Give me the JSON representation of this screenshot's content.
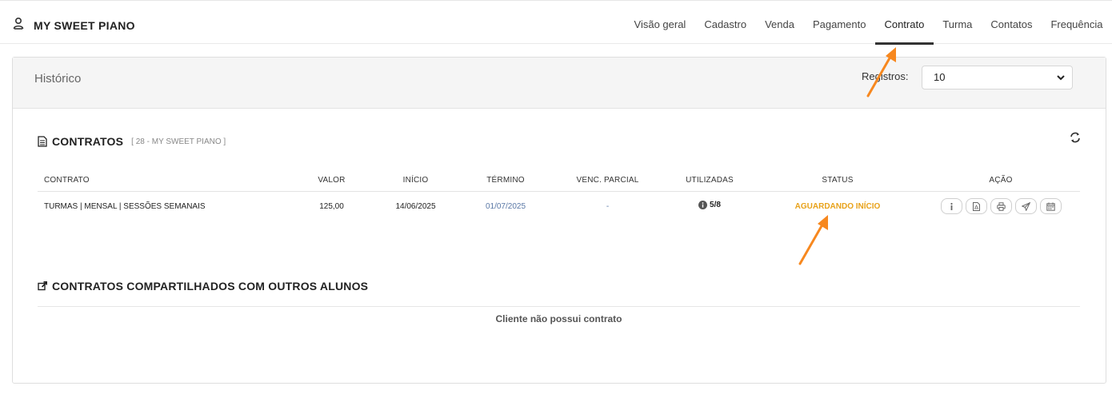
{
  "brand": {
    "name": "MY SWEET PIANO",
    "icon": "user-icon"
  },
  "nav": {
    "items": [
      {
        "label": "Visão geral",
        "active": false
      },
      {
        "label": "Cadastro",
        "active": false
      },
      {
        "label": "Venda",
        "active": false
      },
      {
        "label": "Pagamento",
        "active": false
      },
      {
        "label": "Contrato",
        "active": true
      },
      {
        "label": "Turma",
        "active": false
      },
      {
        "label": "Contatos",
        "active": false
      },
      {
        "label": "Frequência",
        "active": false
      }
    ]
  },
  "panel": {
    "title": "Histórico",
    "registros_label": "Registros:",
    "registros_value": "10"
  },
  "contracts": {
    "title": "CONTRATOS",
    "subtitle": "[ 28 - MY SWEET PIANO ]",
    "columns": [
      "CONTRATO",
      "VALOR",
      "INÍCIO",
      "TÉRMINO",
      "VENC. PARCIAL",
      "UTILIZADAS",
      "STATUS",
      "AÇÃO"
    ],
    "rows": [
      {
        "contrato": "TURMAS | MENSAL | SESSÕES SEMANAIS",
        "valor": "125,00",
        "inicio": "14/06/2025",
        "termino": "01/07/2025",
        "venc_parcial": "-",
        "utilizadas": "5/8",
        "status": "AGUARDANDO INÍCIO"
      }
    ],
    "action_icons": [
      "info-icon",
      "pdf-icon",
      "print-icon",
      "send-icon",
      "calendar-icon"
    ]
  },
  "shared": {
    "title": "CONTRATOS COMPARTILHADOS COM OUTROS ALUNOS",
    "empty_message": "Cliente não possui contrato"
  },
  "colors": {
    "status_waiting": "#e8a21a",
    "date_link": "#5a78a6",
    "annotation_arrow": "#f7881f",
    "active_tab_underline": "#333333"
  }
}
